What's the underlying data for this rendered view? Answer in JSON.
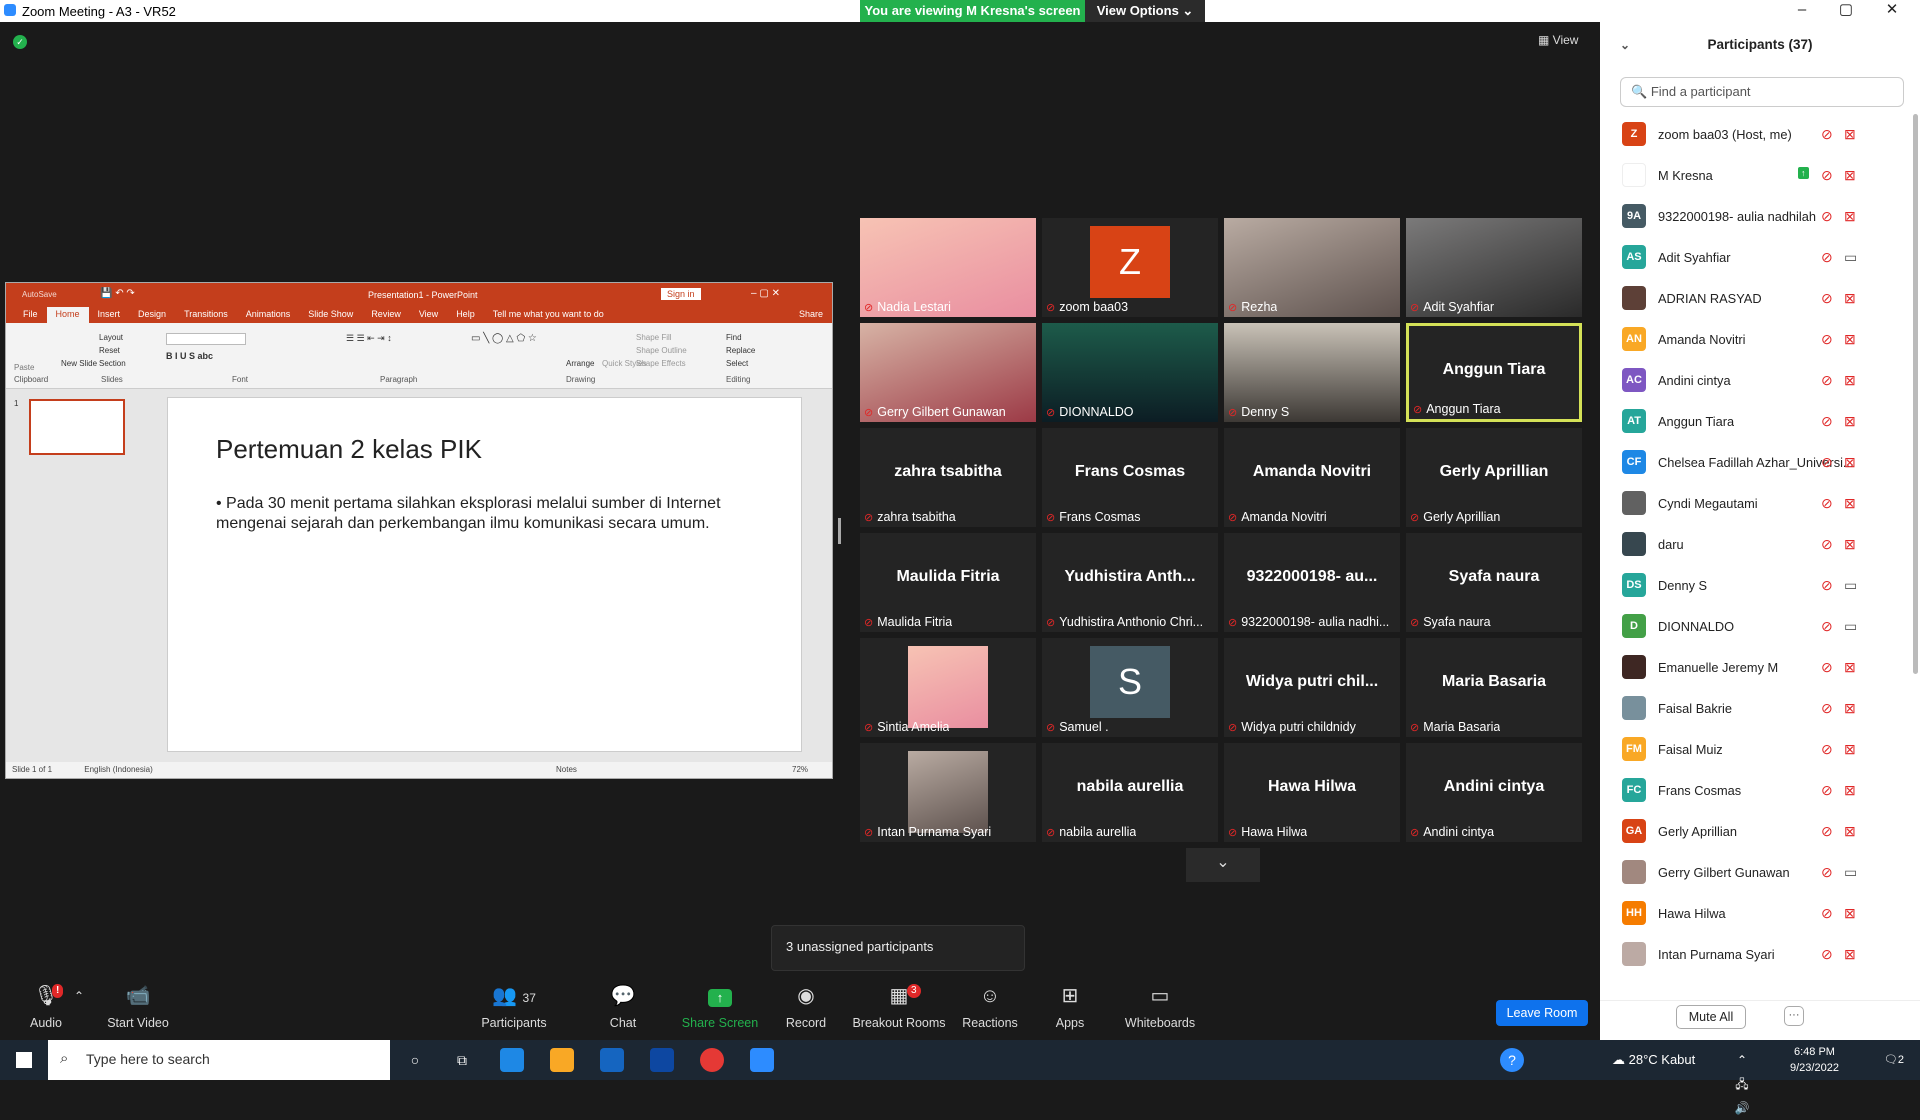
{
  "window": {
    "title": "Zoom Meeting - A3 - VR52"
  },
  "banner": {
    "viewing": "You are viewing M Kresna's screen",
    "view_options": "View Options ⌄"
  },
  "view_label": "View",
  "ppt": {
    "title": "Presentation1 - PowerPoint",
    "autosave": "AutoSave",
    "signin": "Sign in",
    "tabs": [
      "File",
      "Home",
      "Insert",
      "Design",
      "Transitions",
      "Animations",
      "Slide Show",
      "Review",
      "View",
      "Help",
      "Tell me what you want to do"
    ],
    "share": "Share",
    "groups": [
      "Clipboard",
      "Slides",
      "Font",
      "Paragraph",
      "Drawing",
      "Editing"
    ],
    "slide_title": "Pertemuan 2 kelas PIK",
    "slide_bullet": "Pada 30 menit pertama silahkan eksplorasi melalui sumber di Internet mengenai sejarah dan perkembangan ilmu komunikasi secara umum.",
    "status_slide": "Slide 1 of 1",
    "status_lang": "English (Indonesia)",
    "status_notes": "Notes",
    "status_zoom": "72%",
    "ribbon_items": {
      "find": "Find",
      "replace": "Replace",
      "select": "Select",
      "layout": "Layout",
      "reset": "Reset",
      "section": "Section",
      "new_slide": "New Slide",
      "paste": "Paste",
      "arrange": "Arrange",
      "quick_styles": "Quick Styles",
      "shape_fill": "Shape Fill",
      "shape_outline": "Shape Outline",
      "shape_effects": "Shape Effects"
    }
  },
  "gallery": [
    {
      "name": "Nadia Lestari",
      "big": "",
      "type": "photo1"
    },
    {
      "name": "zoom baa03",
      "big": "",
      "type": "z"
    },
    {
      "name": "Rezha",
      "big": "",
      "type": "photo2"
    },
    {
      "name": "Adit Syahfiar",
      "big": "",
      "type": "photo3"
    },
    {
      "name": "Gerry Gilbert Gunawan",
      "big": "",
      "type": "photo4"
    },
    {
      "name": "DIONNALDO",
      "big": "",
      "type": "photo5"
    },
    {
      "name": "Denny S",
      "big": "",
      "type": "photo6"
    },
    {
      "name": "Anggun Tiara",
      "big": "Anggun Tiara",
      "type": "active"
    },
    {
      "name": "zahra tsabitha",
      "big": "zahra tsabitha",
      "type": "text"
    },
    {
      "name": "Frans Cosmas",
      "big": "Frans Cosmas",
      "type": "text"
    },
    {
      "name": "Amanda Novitri",
      "big": "Amanda Novitri",
      "type": "text"
    },
    {
      "name": "Gerly Aprillian",
      "big": "Gerly Aprillian",
      "type": "text"
    },
    {
      "name": "Maulida Fitria",
      "big": "Maulida Fitria",
      "type": "text"
    },
    {
      "name": "Yudhistira Anthonio Chri...",
      "big": "Yudhistira  Anth...",
      "type": "text"
    },
    {
      "name": "9322000198- aulia nadhi...",
      "big": "9322000198- au...",
      "type": "text"
    },
    {
      "name": "Syafa naura",
      "big": "Syafa naura",
      "type": "text"
    },
    {
      "name": "Sintia Amelia",
      "big": "",
      "type": "photo1"
    },
    {
      "name": "Samuel .",
      "big": "",
      "type": "s"
    },
    {
      "name": "Widya putri childnidy",
      "big": "Widya  putri  chil...",
      "type": "text"
    },
    {
      "name": "Maria Basaria",
      "big": "Maria Basaria",
      "type": "text"
    },
    {
      "name": "Intan Purnama Syari",
      "big": "",
      "type": "photo2"
    },
    {
      "name": "nabila aurellia",
      "big": "nabila aurellia",
      "type": "text"
    },
    {
      "name": "Hawa Hilwa",
      "big": "Hawa Hilwa",
      "type": "text"
    },
    {
      "name": "Andini cintya",
      "big": "Andini cintya",
      "type": "text"
    }
  ],
  "gallery_avatars": {
    "z": "Z",
    "s": "S"
  },
  "unassigned": "3 unassigned participants",
  "toolbar": {
    "audio": "Audio",
    "start_video": "Start Video",
    "participants": "Participants",
    "participants_count": "37",
    "chat": "Chat",
    "share_screen": "Share Screen",
    "record": "Record",
    "breakout_rooms": "Breakout Rooms",
    "breakout_badge": "3",
    "reactions": "Reactions",
    "apps": "Apps",
    "whiteboards": "Whiteboards",
    "leave": "Leave Room",
    "audio_badge": "!"
  },
  "panel": {
    "title": "Participants (37)",
    "search_placeholder": "Find a participant",
    "mute_all": "Mute All",
    "more": "···",
    "items": [
      {
        "name": "zoom baa03 (Host, me)",
        "initials": "Z",
        "color": "#d84315",
        "video": "off"
      },
      {
        "name": "M Kresna",
        "initials": "",
        "color": "#ffffff",
        "video": "off",
        "sharing": true
      },
      {
        "name": "9322000198- aulia nadhilah",
        "initials": "9A",
        "color": "#455a64",
        "video": "off"
      },
      {
        "name": "Adit Syahfiar",
        "initials": "AS",
        "color": "#26a69a",
        "video": "on"
      },
      {
        "name": "ADRIAN RASYAD",
        "initials": "",
        "color": "#5d4037",
        "video": "off"
      },
      {
        "name": "Amanda Novitri",
        "initials": "AN",
        "color": "#f9a825",
        "video": "off"
      },
      {
        "name": "Andini cintya",
        "initials": "AC",
        "color": "#7e57c2",
        "video": "off"
      },
      {
        "name": "Anggun Tiara",
        "initials": "AT",
        "color": "#26a69a",
        "video": "off"
      },
      {
        "name": "Chelsea Fadillah Azhar_Universi...",
        "initials": "CF",
        "color": "#1e88e5",
        "video": "off"
      },
      {
        "name": "Cyndi Megautami",
        "initials": "",
        "color": "#616161",
        "video": "off"
      },
      {
        "name": "daru",
        "initials": "",
        "color": "#37474f",
        "video": "off"
      },
      {
        "name": "Denny S",
        "initials": "DS",
        "color": "#26a69a",
        "video": "on"
      },
      {
        "name": "DIONNALDO",
        "initials": "D",
        "color": "#43a047",
        "video": "on"
      },
      {
        "name": "Emanuelle Jeremy M",
        "initials": "",
        "color": "#3e2723",
        "video": "off"
      },
      {
        "name": "Faisal Bakrie",
        "initials": "",
        "color": "#78909c",
        "video": "off"
      },
      {
        "name": "Faisal Muiz",
        "initials": "FM",
        "color": "#f9a825",
        "video": "off"
      },
      {
        "name": "Frans Cosmas",
        "initials": "FC",
        "color": "#26a69a",
        "video": "off"
      },
      {
        "name": "Gerly Aprillian",
        "initials": "GA",
        "color": "#d84315",
        "video": "off"
      },
      {
        "name": "Gerry Gilbert Gunawan",
        "initials": "",
        "color": "#a1887f",
        "video": "on"
      },
      {
        "name": "Hawa Hilwa",
        "initials": "HH",
        "color": "#f57c00",
        "video": "off"
      },
      {
        "name": "Intan Purnama Syari",
        "initials": "",
        "color": "#bcaaa4",
        "video": "off"
      }
    ]
  },
  "taskbar": {
    "search": "Type here to search",
    "time": "6:48 PM",
    "date": "9/23/2022",
    "weather": "28°C  Kabut",
    "notif": "2"
  },
  "colors": {
    "green": "#23b14d",
    "red": "#e02828",
    "zoom_blue": "#0e72ed",
    "ppt_red": "#c43e1c"
  }
}
